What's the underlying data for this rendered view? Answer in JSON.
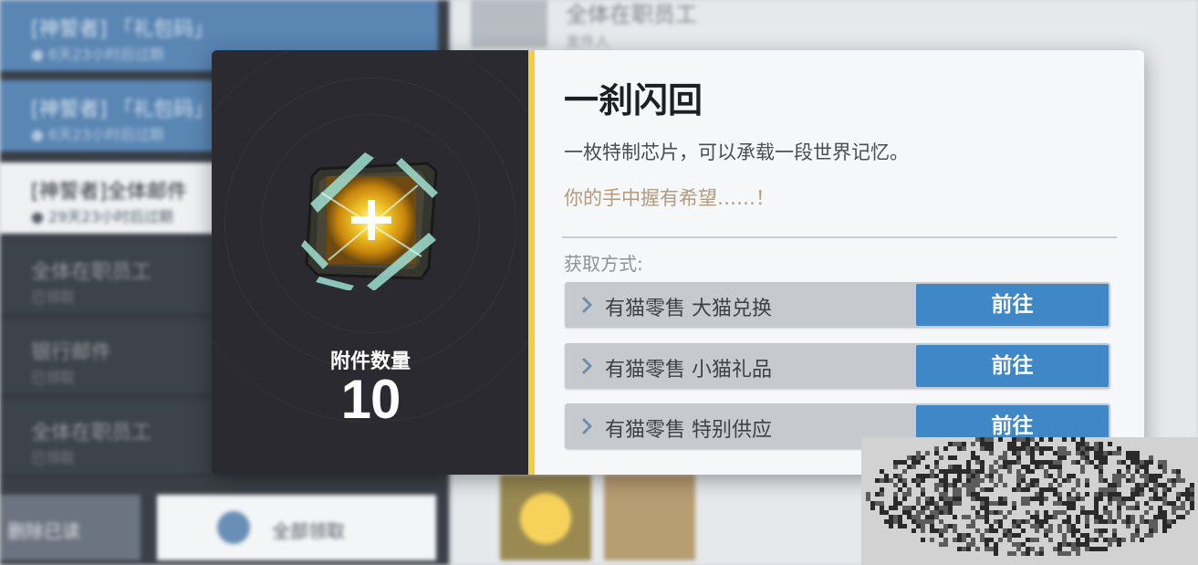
{
  "popup": {
    "item_name": "一刹闪回",
    "description": "一枚特制芯片，可以承载一段世界记忆。",
    "flavor_text": "你的手中握有希望……！",
    "attachment_count_label": "附件数量",
    "attachment_count": "10",
    "source_section_title": "获取方式:",
    "sources": [
      {
        "label": "有猫零售 大猫兑换",
        "button": "前往"
      },
      {
        "label": "有猫零售 小猫礼品",
        "button": "前往"
      },
      {
        "label": "有猫零售 特别供应",
        "button": "前往"
      }
    ],
    "accent_color": "#f1cd45",
    "button_color": "#3f87c7",
    "item_icon": "golden-chip-icon"
  },
  "background": {
    "mail_list": [
      {
        "title": "[神誓者] 「礼包码」",
        "sub": "● 6天23小时后过期"
      },
      {
        "title": "[神誓者] 「礼包码」",
        "sub": "● 6天23小时后过期"
      },
      {
        "title": "[神誓者]全体邮件",
        "sub": "● 29天23小时后过期"
      },
      {
        "title": "全体在职员工",
        "sub": "已领取"
      },
      {
        "title": "银行邮件",
        "sub": "已领取"
      },
      {
        "title": "全体在职员工",
        "sub": "已领取"
      }
    ],
    "delete_read_button": "删除已读",
    "claim_all_button": "全部领取",
    "mail_header_title": "全体在职员工",
    "mail_header_sub": "发件人"
  }
}
